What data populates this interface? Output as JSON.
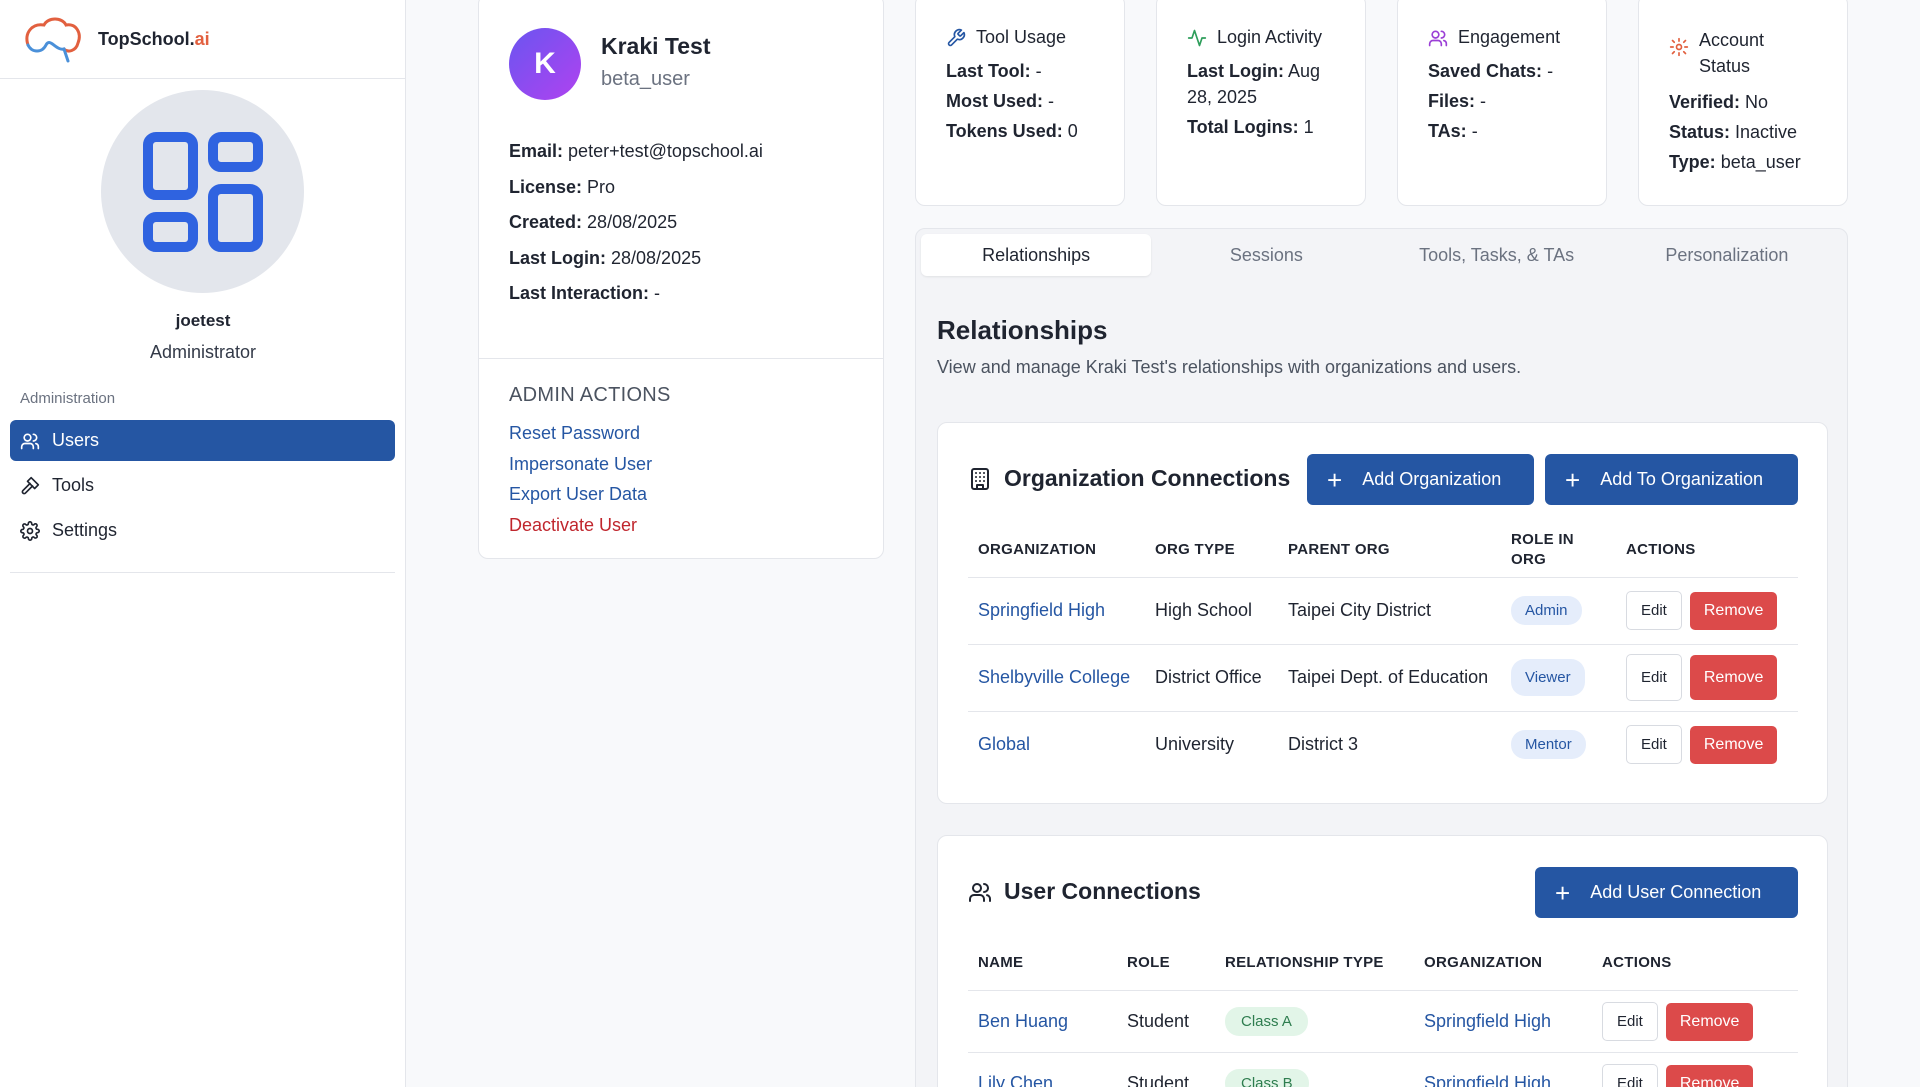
{
  "brand": {
    "name_main": "TopSchool.",
    "name_ai": "ai"
  },
  "sidebar": {
    "username": "joetest",
    "role": "Administrator",
    "section_label": "Administration",
    "items": [
      {
        "label": "Users",
        "icon": "users-icon",
        "active": true
      },
      {
        "label": "Tools",
        "icon": "hammer-icon",
        "active": false
      },
      {
        "label": "Settings",
        "icon": "gear-icon",
        "active": false
      }
    ]
  },
  "profile": {
    "initial": "K",
    "name": "Kraki Test",
    "username": "beta_user",
    "info": [
      {
        "label": "Email:",
        "value": "peter+test@topschool.ai"
      },
      {
        "label": "License:",
        "value": "Pro"
      },
      {
        "label": "Created:",
        "value": "28/08/2025"
      },
      {
        "label": "Last Login:",
        "value": "28/08/2025"
      },
      {
        "label": "Last Interaction:",
        "value": "-"
      }
    ],
    "admin_actions_title": "ADMIN ACTIONS",
    "admin_actions": [
      "Reset Password",
      "Impersonate User",
      "Export User Data",
      "Deactivate User"
    ]
  },
  "stats": {
    "tool_usage": {
      "title": "Tool Usage",
      "lines": [
        {
          "label": "Last Tool:",
          "value": "-"
        },
        {
          "label": "Most Used:",
          "value": "-"
        },
        {
          "label": "Tokens Used:",
          "value": "0"
        }
      ]
    },
    "login_activity": {
      "title": "Login Activity",
      "lines": [
        {
          "label": "Last Login:",
          "value": "Aug 28, 2025"
        },
        {
          "label": "Total Logins:",
          "value": "1"
        }
      ]
    },
    "engagement": {
      "title": "Engagement",
      "lines": [
        {
          "label": "Saved Chats:",
          "value": "-"
        },
        {
          "label": "Files:",
          "value": "-"
        },
        {
          "label": "TAs:",
          "value": "-"
        }
      ]
    },
    "account_status": {
      "title": "Account Status",
      "lines": [
        {
          "label": "Verified:",
          "value": "No"
        },
        {
          "label": "Status:",
          "value": "Inactive"
        },
        {
          "label": "Type:",
          "value": "beta_user"
        }
      ]
    }
  },
  "tabs": [
    "Relationships",
    "Sessions",
    "Tools, Tasks, & TAs",
    "Personalization"
  ],
  "relationships": {
    "title": "Relationships",
    "description": "View and manage Kraki Test's relationships with organizations and users."
  },
  "org_connections": {
    "title": "Organization Connections",
    "add_org_label": "Add Organization",
    "add_to_org_label": "Add To Organization",
    "headers": [
      "ORGANIZATION",
      "ORG TYPE",
      "PARENT ORG",
      "ROLE IN ORG",
      "ACTIONS"
    ],
    "rows": [
      {
        "org": "Springfield High",
        "type": "High School",
        "parent": "Taipei City District",
        "role": "Admin"
      },
      {
        "org": "Shelbyville College",
        "type": "District Office",
        "parent": "Taipei Dept. of Education",
        "role": "Viewer"
      },
      {
        "org": "Global",
        "type": "University",
        "parent": "District 3",
        "role": "Mentor"
      }
    ]
  },
  "user_connections": {
    "title": "User Connections",
    "add_label": "Add User Connection",
    "headers": [
      "NAME",
      "ROLE",
      "RELATIONSHIP TYPE",
      "ORGANIZATION",
      "ACTIONS"
    ],
    "rows": [
      {
        "name": "Ben Huang",
        "role": "Student",
        "rel": "Class A",
        "org": "Springfield High"
      },
      {
        "name": "Lily Chen",
        "role": "Student",
        "rel": "Class B",
        "org": "Springfield High"
      }
    ]
  },
  "actions": {
    "edit": "Edit",
    "remove": "Remove"
  },
  "colors": {
    "primary": "#2556a3",
    "danger": "#dc4a4a",
    "brand_accent": "#e2603f"
  }
}
